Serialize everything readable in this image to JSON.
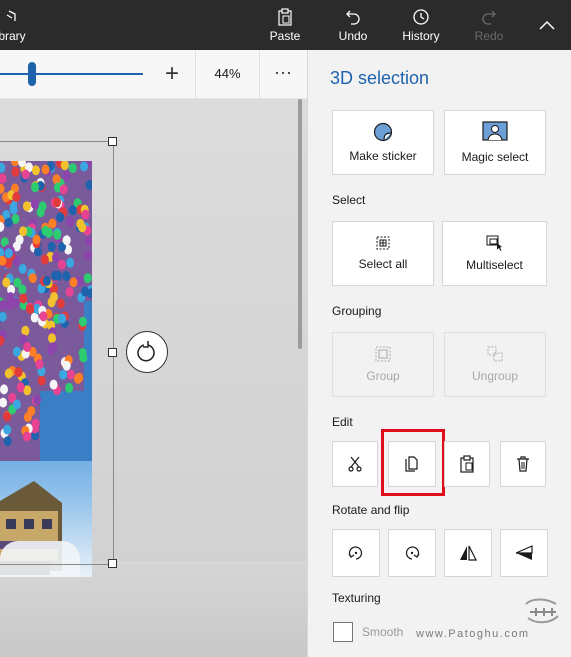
{
  "topbar": {
    "library_label": "brary",
    "paste_label": "Paste",
    "undo_label": "Undo",
    "history_label": "History",
    "redo_label": "Redo"
  },
  "zoom": {
    "value_label": "44%",
    "more_label": "···",
    "slider_fraction": 0.21
  },
  "panel": {
    "title": "3D selection",
    "make_sticker_label": "Make sticker",
    "magic_select_label": "Magic select",
    "select_section": "Select",
    "select_all_label": "Select all",
    "multiselect_label": "Multiselect",
    "grouping_section": "Grouping",
    "group_label": "Group",
    "ungroup_label": "Ungroup",
    "edit_section": "Edit",
    "rotate_flip_section": "Rotate and flip",
    "texturing_section": "Texturing",
    "smooth_label": "Smooth"
  },
  "edit_buttons": [
    "cut-icon",
    "copy-icon",
    "paste-icon",
    "delete-icon"
  ],
  "rotate_buttons": [
    "rotate-left-icon",
    "rotate-right-icon",
    "flip-horizontal-icon",
    "flip-vertical-icon"
  ],
  "watermark": {
    "text": "www.Patoghu.com",
    "logo_text": "پاتوق"
  },
  "colors": {
    "accent": "#1f62ad",
    "highlight": "#e00d1b",
    "topbar": "#2b2b2b"
  }
}
